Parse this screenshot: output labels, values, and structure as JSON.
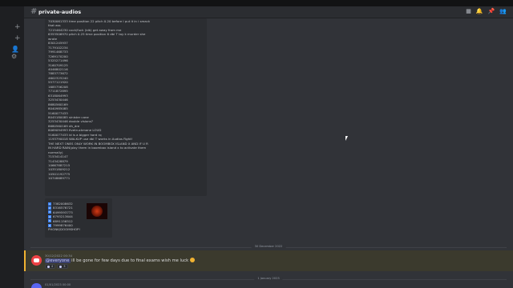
{
  "channel": {
    "name": "private-audios"
  },
  "message_lines": [
    "7030061333 time position 22 pitch 0.20 before I put it in i smack",
    "that ass",
    "7215464230 cock/fuck (idk) get away from me",
    "6353506970 pitch 0.25 time position 6 dbl T tay k murder she",
    "wrote",
    "8301245937",
    "7179102234",
    "7991468733",
    "7269170200",
    "5325271496",
    "3160709125",
    "4046802116",
    "7883773672",
    "4602325240",
    "5577121920",
    "1685756208",
    "7711872895",
    "6318064993",
    "3253430446",
    "8680560169",
    "8040985085",
    "5160077433",
    "8045180085 sinister cane",
    "3253430446 double visions?",
    "8680560169 dh_dre",
    "8069094993 fivetruckmane LOUD",
    "5160077433 id is a bigger hard rq",
    "1193790018 WALKUP use dbl T works in Audios Fight!",
    "THE NEXT ONES ONLY WORK IN BOOMBOX ISLAND X AND IF U R",
    "IN HARD RAIN(play them in boombox island x to activate them",
    "normally)",
    "7153414147",
    "7143428879",
    "10667887215",
    "10351809212",
    "10501192775",
    "10748689771"
  ],
  "embed": {
    "items": [
      {
        "num": "1",
        "text": "7382008632"
      },
      {
        "num": "2",
        "text": "8316576721"
      },
      {
        "num": "3",
        "text": "6499593773"
      },
      {
        "num": "4",
        "text": "6793213644"
      },
      {
        "num": "5",
        "text": "6891156512"
      },
      {
        "num": "6",
        "text": "7999876400"
      }
    ],
    "footer": "PHONK/DOOMSHOP!"
  },
  "dividers": {
    "first": "30 December 2022",
    "second": "1 January 2023"
  },
  "message2": {
    "meta": "30/12/2022 00:34",
    "mention": "@everyone",
    "text": " ill be gone for few days due to final exams wish me luck",
    "reactions": [
      {
        "emoji": "pray-emoji",
        "count": "4"
      },
      {
        "emoji": "clover-emoji",
        "count": "3"
      }
    ]
  },
  "message3": {
    "meta": "01/01/2023 00:00"
  },
  "colors": {
    "background": "#313338",
    "highlight": "#3b3a2d",
    "highlight_border": "#f0b232",
    "mention": "#3c4270",
    "avatar": "#ed4245"
  }
}
